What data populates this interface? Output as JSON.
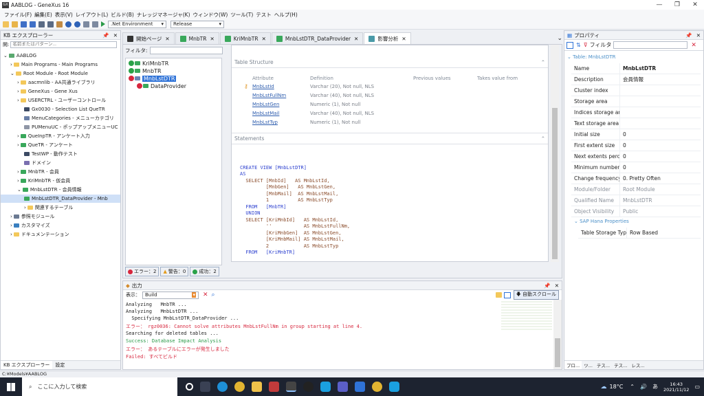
{
  "window": {
    "title": "AABLOG - GeneXus 16",
    "app_icon_text": "GX"
  },
  "menu": [
    "ファイル(F)",
    "編集(E)",
    "表示(V)",
    "レイアウト(L)",
    "ビルド(B)",
    "ナレッジマネージャ(K)",
    "ウィンドウ(W)",
    "ツール(T)",
    "テスト",
    "ヘルプ(H)"
  ],
  "toolbar": {
    "environment": ".Net Environment",
    "configuration": "Release"
  },
  "kb_explorer": {
    "title": "KB エクスプローラー",
    "filter_label": "開:",
    "filter_placeholder": "名前またはパターン...",
    "nodes": [
      "AABLOG",
      "Main Programs - Main Programs",
      "Root Module - Root Module",
      "aacmnlib - AA共通ライブラリ",
      "GeneXus - Gene Xus",
      "USERCTRL - ユーザーコントロール",
      "Gx0030 - Selection List QueTR",
      "MenuCategories - メニューカテゴリ",
      "PUMenuUC - ポップアップメニューUC",
      "QueInpTR - アンケート入力",
      "QueTR - アンケート",
      "TestWP - 動作テスト",
      "ドメイン",
      "MnbTR - 会員",
      "KriMnbTR - 仮会員",
      "MnbLstDTR - 会員情報",
      "MnbLstDTR_DataProvider - Mnb",
      "関連するテーブル",
      "参照モジュール",
      "カスタマイズ",
      "ドキュメンテーション"
    ],
    "bottom_tabs": [
      "KB エクスプローラー",
      "設定"
    ]
  },
  "tabs": [
    "開始ページ",
    "MnbTR",
    "KriMnbTR",
    "MnbLstDTR_DataProvider",
    "影響分析"
  ],
  "impact": {
    "filter_label": "フィルタ:",
    "objects": [
      "KriMnbTR",
      "MnbTR",
      "MnbLstDTR",
      "DataProvider"
    ],
    "table_structure_title": "Table Structure",
    "columns": [
      "Attribute",
      "Definition",
      "Previous values",
      "Takes value from"
    ],
    "rows": [
      {
        "attr": "MnbLstId",
        "def": "Varchar (20), Not null, NLS"
      },
      {
        "attr": "MnbLstFullNm",
        "def": "Varchar (40), Not null, NLS"
      },
      {
        "attr": "MnbLstGen",
        "def": "Numeric (1), Not null"
      },
      {
        "attr": "MnbLstMail",
        "def": "Varchar (40), Not null, NLS"
      },
      {
        "attr": "MnbLstTyp",
        "def": "Numeric (1), Not null"
      }
    ],
    "statements_title": "Statements",
    "status": {
      "errors": "エラー：2",
      "warnings": "警告：0",
      "success": "成功：2"
    }
  },
  "sql": {
    "l1": "CREATE VIEW [MnbLstDTR]",
    "l2": "AS",
    "l3": "  SELECT [MnbId]   AS MnbLstId,",
    "l4": "         [MnbGen]   AS MnbLstGen,",
    "l5": "         [MnbMail]  AS MnbLstMail,",
    "l6": "         1          AS MnbLstTyp",
    "l7": "  FROM   [MnbTR]",
    "l8": "  UNION",
    "l9": "  SELECT [KriMnbId]   AS MnbLstId,",
    "l10": "         ''           AS MnbLstFullNm,",
    "l11": "         [KriMnbGen]  AS MnbLstGen,",
    "l12": "         [KriMnbMail] AS MnbLstMail,",
    "l13": "         2            AS MnbLstTyp",
    "l14": "  FROM   [KriMnbTR]"
  },
  "output": {
    "title": "出力",
    "show_label": "表示：",
    "show_value": "Build",
    "autoscroll": "自動スクロール",
    "lines": [
      "Analyzing   MnbTR ...",
      "Analyzing   MnbLstDTR ...",
      "  Specifying MnbLstDTR_DataProvider ...",
      "エラー： rgz0036: Cannot solve attributes MnbLstFullNm in group starting at line 4.",
      "Searching for deleted tables ...",
      "Success: Database Impact Analysis",
      "エラー： あるテーブルにエラーが発生しました",
      "Failed: すべてビルド"
    ]
  },
  "properties": {
    "title": "プロパティ",
    "filter_label": "フィルタ",
    "group_title": "Table: MnbLstDTR",
    "rows": [
      {
        "k": "Name",
        "v": "MnbLstDTR"
      },
      {
        "k": "Description",
        "v": "会員情報"
      },
      {
        "k": "Cluster index",
        "v": ""
      },
      {
        "k": "Storage area",
        "v": ""
      },
      {
        "k": "Indices storage area",
        "v": ""
      },
      {
        "k": "Text storage area",
        "v": ""
      },
      {
        "k": "Initial size",
        "v": "0"
      },
      {
        "k": "First extent size",
        "v": "0"
      },
      {
        "k": "Next extents percent",
        "v": "0"
      },
      {
        "k": "Minimum number of",
        "v": "0"
      },
      {
        "k": "Change frequency",
        "v": "0. Pretty Often"
      },
      {
        "k": "Module/Folder",
        "v": "Root Module"
      },
      {
        "k": "Qualified Name",
        "v": "MnbLstDTR"
      },
      {
        "k": "Object Visibility",
        "v": "Public"
      }
    ],
    "sap_group": "SAP Hana Properties",
    "sap_row": {
      "k": "Table Storage Type",
      "v": "Row Based"
    },
    "bottom_tabs": [
      "プロ...",
      "ツ...",
      "テス...",
      "テス...",
      "レス..."
    ]
  },
  "statusbar": "C:¥Models¥AABLOG",
  "taskbar": {
    "search_placeholder": "ここに入力して検索",
    "temp": "18°C",
    "time": "16:43",
    "date": "2021/11/12"
  }
}
